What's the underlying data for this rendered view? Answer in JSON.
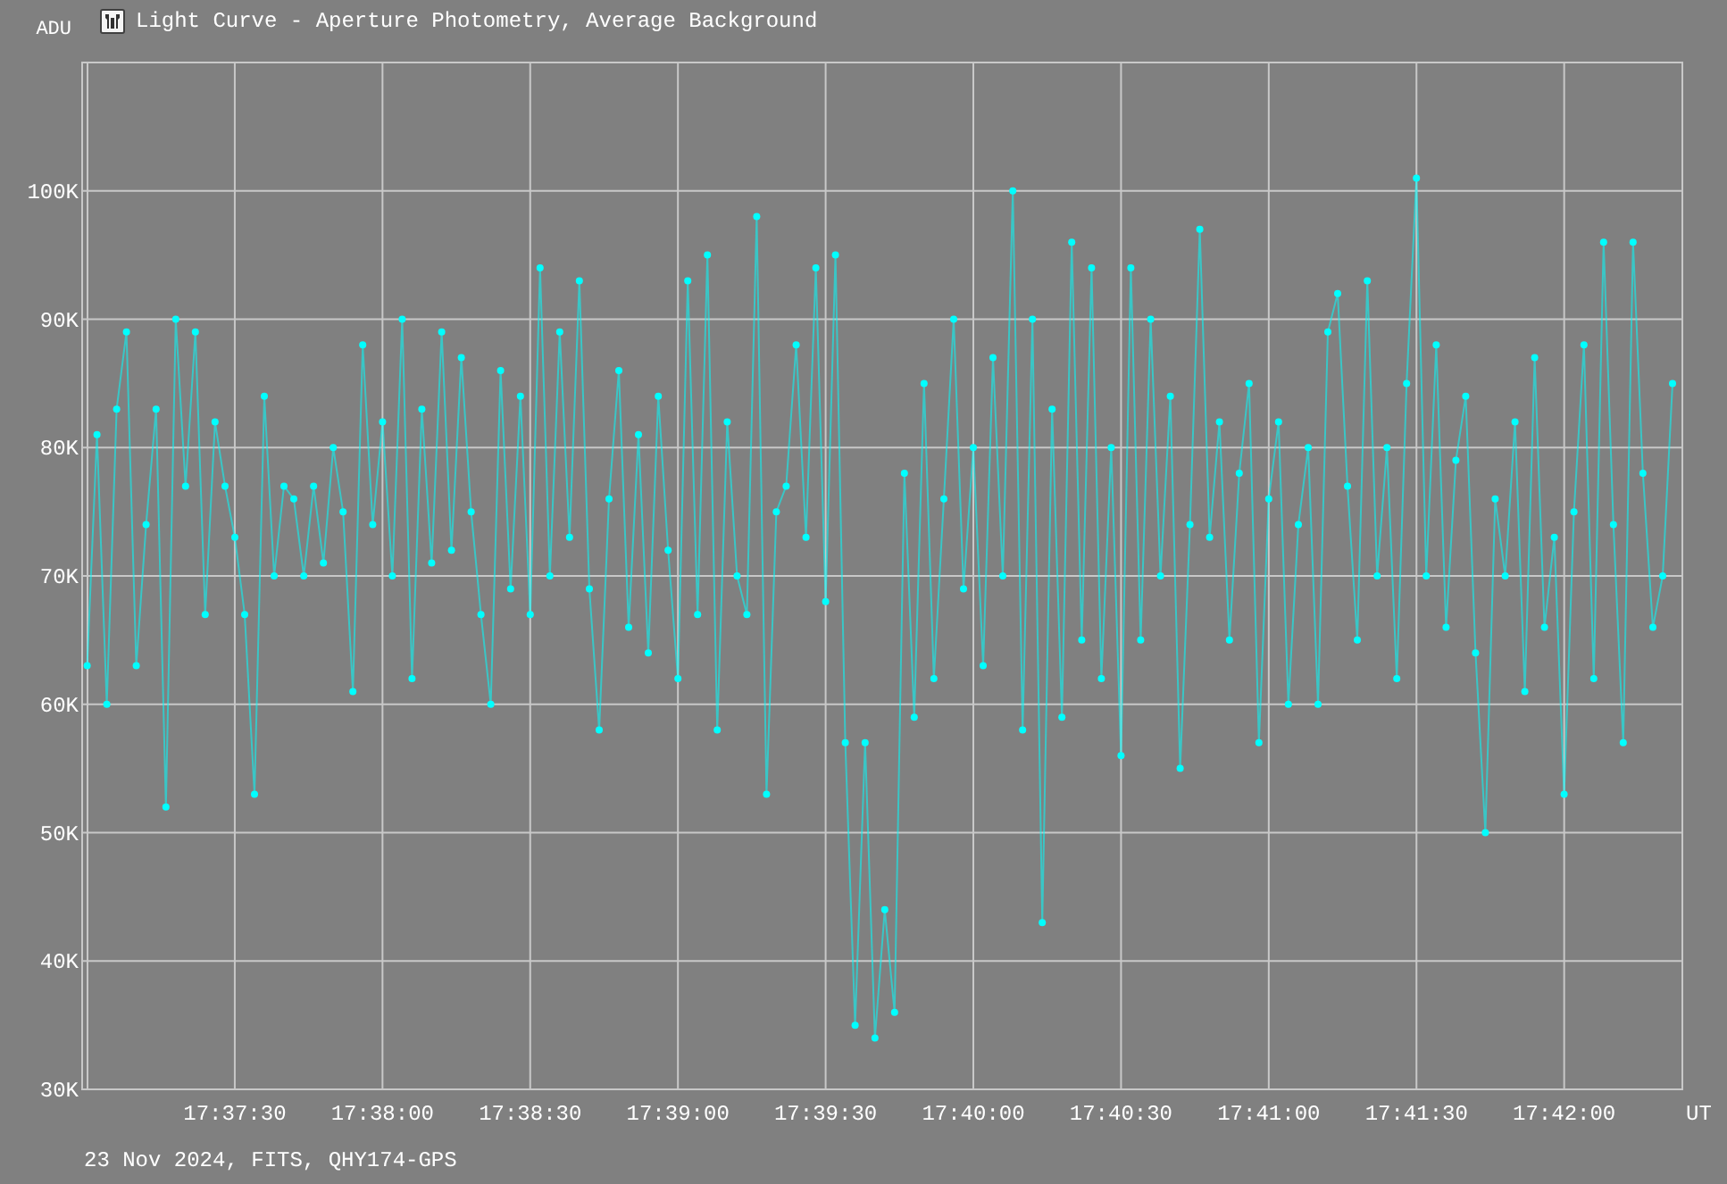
{
  "chart": {
    "chart_data": {
      "type": "line",
      "grid": true,
      "title": "Light Curve - Aperture Photometry, Average Background",
      "xlabel": "UT",
      "ylabel": "ADU",
      "x": [
        63420,
        63422,
        63424,
        63426,
        63428,
        63430,
        63432,
        63434,
        63436,
        63438,
        63440,
        63442,
        63444,
        63446,
        63448,
        63450,
        63452,
        63454,
        63456,
        63458,
        63460,
        63462,
        63464,
        63466,
        63468,
        63470,
        63472,
        63474,
        63476,
        63478,
        63480,
        63482,
        63484,
        63486,
        63488,
        63490,
        63492,
        63494,
        63496,
        63498,
        63500,
        63502,
        63504,
        63506,
        63508,
        63510,
        63512,
        63514,
        63516,
        63518,
        63520,
        63522,
        63524,
        63526,
        63528,
        63530,
        63532,
        63534,
        63536,
        63538,
        63540,
        63542,
        63544,
        63546,
        63548,
        63550,
        63552,
        63554,
        63556,
        63558,
        63560,
        63562,
        63564,
        63566,
        63568,
        63570,
        63572,
        63574,
        63576,
        63578,
        63580,
        63582,
        63584,
        63586,
        63588,
        63590,
        63592,
        63594,
        63596,
        63598,
        63600,
        63602,
        63604,
        63606,
        63608,
        63610,
        63612,
        63614,
        63616,
        63618,
        63620,
        63622,
        63624,
        63626,
        63628,
        63630,
        63632,
        63634,
        63636,
        63638,
        63640,
        63642,
        63644,
        63646,
        63648,
        63650,
        63652,
        63654,
        63656,
        63658,
        63660,
        63662,
        63664,
        63666,
        63668,
        63670,
        63672,
        63674,
        63676,
        63678,
        63680,
        63682,
        63684,
        63686,
        63688,
        63690,
        63692,
        63694,
        63696,
        63698,
        63700,
        63702,
        63704,
        63706,
        63708,
        63710,
        63712,
        63714,
        63716,
        63718,
        63720,
        63722,
        63724,
        63726,
        63728,
        63730,
        63732,
        63734,
        63736,
        63738,
        63740,
        63742
      ],
      "series": [
        {
          "color": "#00ffff",
          "marker": "circle",
          "values": [
            63,
            81,
            60,
            83,
            89,
            63,
            74,
            83,
            52,
            90,
            77,
            89,
            67,
            82,
            77,
            73,
            67,
            53,
            84,
            70,
            77,
            76,
            70,
            77,
            71,
            80,
            75,
            61,
            88,
            74,
            82,
            70,
            90,
            62,
            83,
            71,
            89,
            72,
            87,
            75,
            67,
            60,
            86,
            69,
            84,
            67,
            94,
            70,
            89,
            73,
            93,
            69,
            58,
            76,
            86,
            66,
            81,
            64,
            84,
            72,
            62,
            93,
            67,
            95,
            58,
            82,
            70,
            67,
            98,
            53,
            75,
            77,
            88,
            73,
            94,
            68,
            95,
            57,
            35,
            57,
            34,
            44,
            36,
            78,
            59,
            85,
            62,
            76,
            90,
            69,
            80,
            63,
            87,
            70,
            100,
            58,
            90,
            43,
            83,
            59,
            96,
            65,
            94,
            62,
            80,
            56,
            94,
            65,
            90,
            70,
            84,
            55,
            74,
            97,
            73,
            82,
            65,
            78,
            85,
            57,
            76,
            82,
            60,
            74,
            80,
            60,
            89,
            92,
            77,
            65,
            93,
            70,
            80,
            62,
            85,
            101,
            70,
            88,
            66,
            79,
            84,
            64,
            50,
            76,
            70,
            82,
            61,
            87,
            66,
            73,
            53,
            75,
            88,
            62,
            96,
            74,
            57,
            96,
            78,
            66,
            70,
            85
          ]
        }
      ],
      "xlim": [
        63419,
        63744
      ],
      "ylim": [
        30,
        110
      ],
      "xticks": [
        {
          "value": 63450,
          "label": "17:37:30"
        },
        {
          "value": 63480,
          "label": "17:38:00"
        },
        {
          "value": 63510,
          "label": "17:38:30"
        },
        {
          "value": 63540,
          "label": "17:39:00"
        },
        {
          "value": 63570,
          "label": "17:39:30"
        },
        {
          "value": 63600,
          "label": "17:40:00"
        },
        {
          "value": 63630,
          "label": "17:40:30"
        },
        {
          "value": 63660,
          "label": "17:41:00"
        },
        {
          "value": 63690,
          "label": "17:41:30"
        },
        {
          "value": 63720,
          "label": "17:42:00"
        }
      ],
      "yticks": [
        {
          "value": 30,
          "label": "30K"
        },
        {
          "value": 40,
          "label": "40K"
        },
        {
          "value": 50,
          "label": "50K"
        },
        {
          "value": 60,
          "label": "60K"
        },
        {
          "value": 70,
          "label": "70K"
        },
        {
          "value": 80,
          "label": "80K"
        },
        {
          "value": 90,
          "label": "90K"
        },
        {
          "value": 100,
          "label": "100K"
        }
      ]
    }
  },
  "footer": {
    "text": "23 Nov 2024, FITS, QHY174-GPS"
  }
}
